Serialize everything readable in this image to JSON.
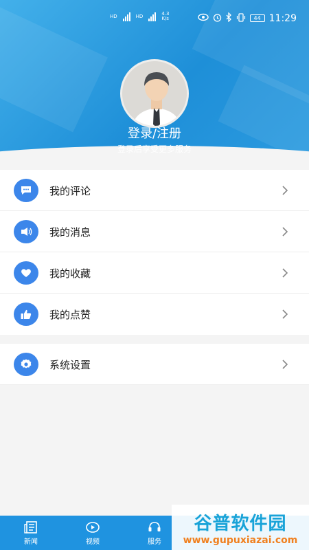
{
  "status_bar": {
    "network_left": "HD",
    "network_right": "HD",
    "speed": "4.3",
    "speed_unit": "K/s",
    "battery": "44",
    "time": "11:29"
  },
  "profile": {
    "title": "登录/注册",
    "subtitle": "登录后享受更多服务"
  },
  "menu": {
    "items": [
      {
        "label": "我的评论",
        "icon": "comment-icon"
      },
      {
        "label": "我的消息",
        "icon": "speaker-icon"
      },
      {
        "label": "我的收藏",
        "icon": "heart-icon"
      },
      {
        "label": "我的点赞",
        "icon": "thumbs-up-icon"
      }
    ]
  },
  "settings": {
    "label": "系统设置",
    "icon": "gear-icon"
  },
  "tabbar": {
    "tabs": [
      {
        "label": "新闻",
        "icon": "news-icon"
      },
      {
        "label": "视频",
        "icon": "video-icon"
      },
      {
        "label": "服务",
        "icon": "service-icon"
      }
    ]
  },
  "watermark": {
    "title": "谷普软件园",
    "url": "www.gupuxiazai.com"
  },
  "colors": {
    "primary": "#1f93e0",
    "icon_blue": "#3c86ea",
    "background": "#f4f4f4"
  }
}
